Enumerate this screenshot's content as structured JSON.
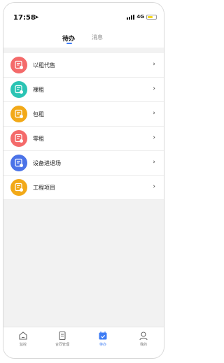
{
  "status_bar": {
    "time": "17:58",
    "location_glyph": "➤",
    "network": "4G"
  },
  "tabs": {
    "pending": "待办",
    "messages": "消息"
  },
  "items": [
    {
      "label": "以租代售",
      "color": "#f46a6a",
      "icon": "contract-icon"
    },
    {
      "label": "裸租",
      "color": "#2bc4b4",
      "icon": "contract-icon"
    },
    {
      "label": "包租",
      "color": "#f2a918",
      "icon": "contract-icon"
    },
    {
      "label": "零租",
      "color": "#f46a6a",
      "icon": "contract-icon"
    },
    {
      "label": "设备进退场",
      "color": "#4b73e8",
      "icon": "contract-icon"
    },
    {
      "label": "工程项目",
      "color": "#f2a918",
      "icon": "contract-icon"
    }
  ],
  "chevron": "›",
  "bottom_nav": [
    {
      "label": "监控",
      "icon": "home-icon",
      "active": false
    },
    {
      "label": "合同管理",
      "icon": "document-icon",
      "active": false
    },
    {
      "label": "待办",
      "icon": "calendar-check-icon",
      "active": true
    },
    {
      "label": "我的",
      "icon": "user-icon",
      "active": false
    }
  ],
  "colors": {
    "accent": "#3d7cf5"
  }
}
